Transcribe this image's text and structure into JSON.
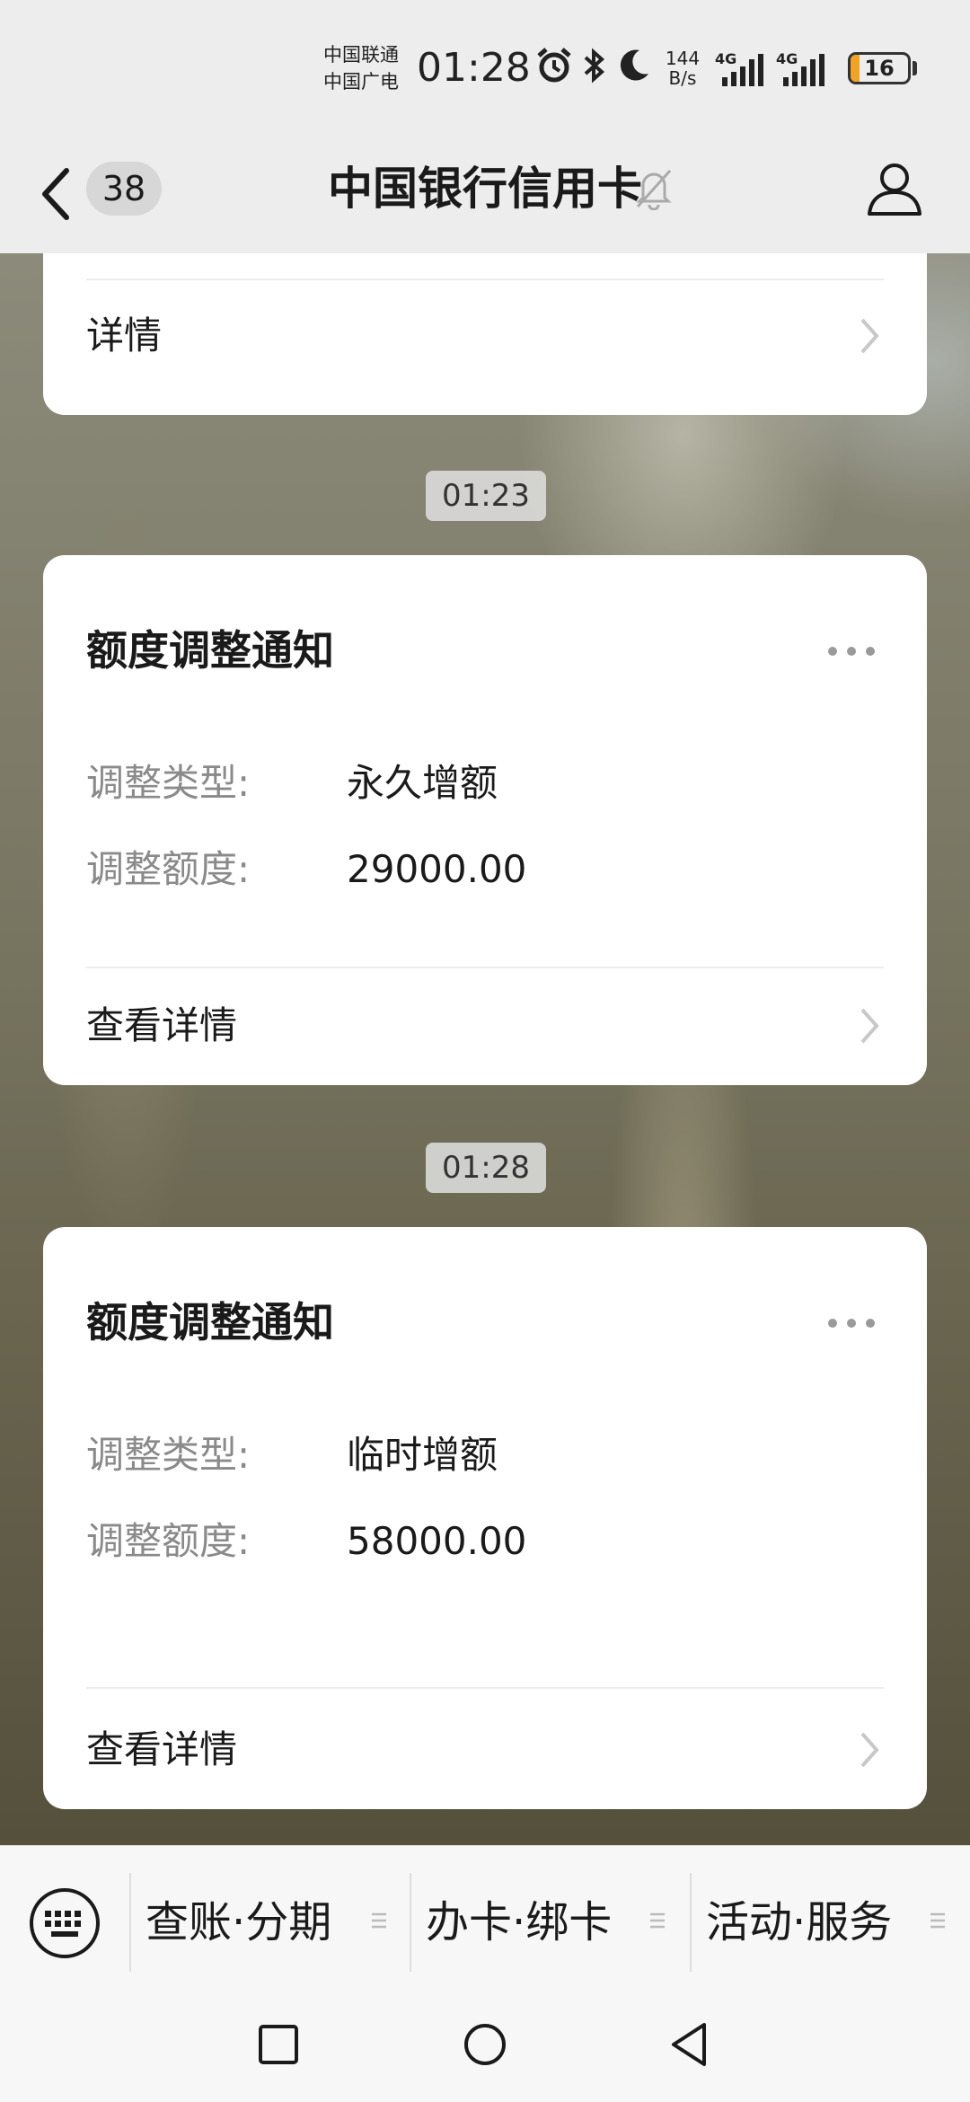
{
  "status_bar": {
    "carrier_1": "中国联通",
    "carrier_2": "中国广电",
    "time": "01:28",
    "net_speed_value": "144",
    "net_speed_unit": "B/s",
    "network_1": "4G",
    "network_2": "4G",
    "battery_level": "16",
    "battery_fraction": 0.16,
    "icons": [
      "alarm-icon",
      "bluetooth-icon",
      "moon-icon",
      "signal-icon",
      "battery-icon"
    ]
  },
  "header": {
    "unread_count": "38",
    "title": "中国银行信用卡",
    "icons": [
      "back-arrow-icon",
      "mute-bell-icon",
      "profile-icon"
    ]
  },
  "chat": {
    "partial_card": {
      "link_label": "详情"
    },
    "messages": [
      {
        "timestamp": "01:23",
        "title": "额度调整通知",
        "fields": [
          {
            "label": "调整类型:",
            "value": "永久增额"
          },
          {
            "label": "调整额度:",
            "value": "29000.00"
          }
        ],
        "link_label": "查看详情"
      },
      {
        "timestamp": "01:28",
        "title": "额度调整通知",
        "fields": [
          {
            "label": "调整类型:",
            "value": "临时增额"
          },
          {
            "label": "调整额度:",
            "value": "58000.00"
          }
        ],
        "link_label": "查看详情"
      }
    ]
  },
  "menu": {
    "items": [
      {
        "label": "查账·分期"
      },
      {
        "label": "办卡·绑卡"
      },
      {
        "label": "活动·服务"
      }
    ]
  },
  "navbar": {
    "icons": [
      "recent-apps-icon",
      "home-icon",
      "back-icon"
    ]
  },
  "colors": {
    "header_bg": "#ededed",
    "card_bg": "#ffffff",
    "battery_fill": "#f0a325",
    "label_gray": "#8a8a8a"
  }
}
